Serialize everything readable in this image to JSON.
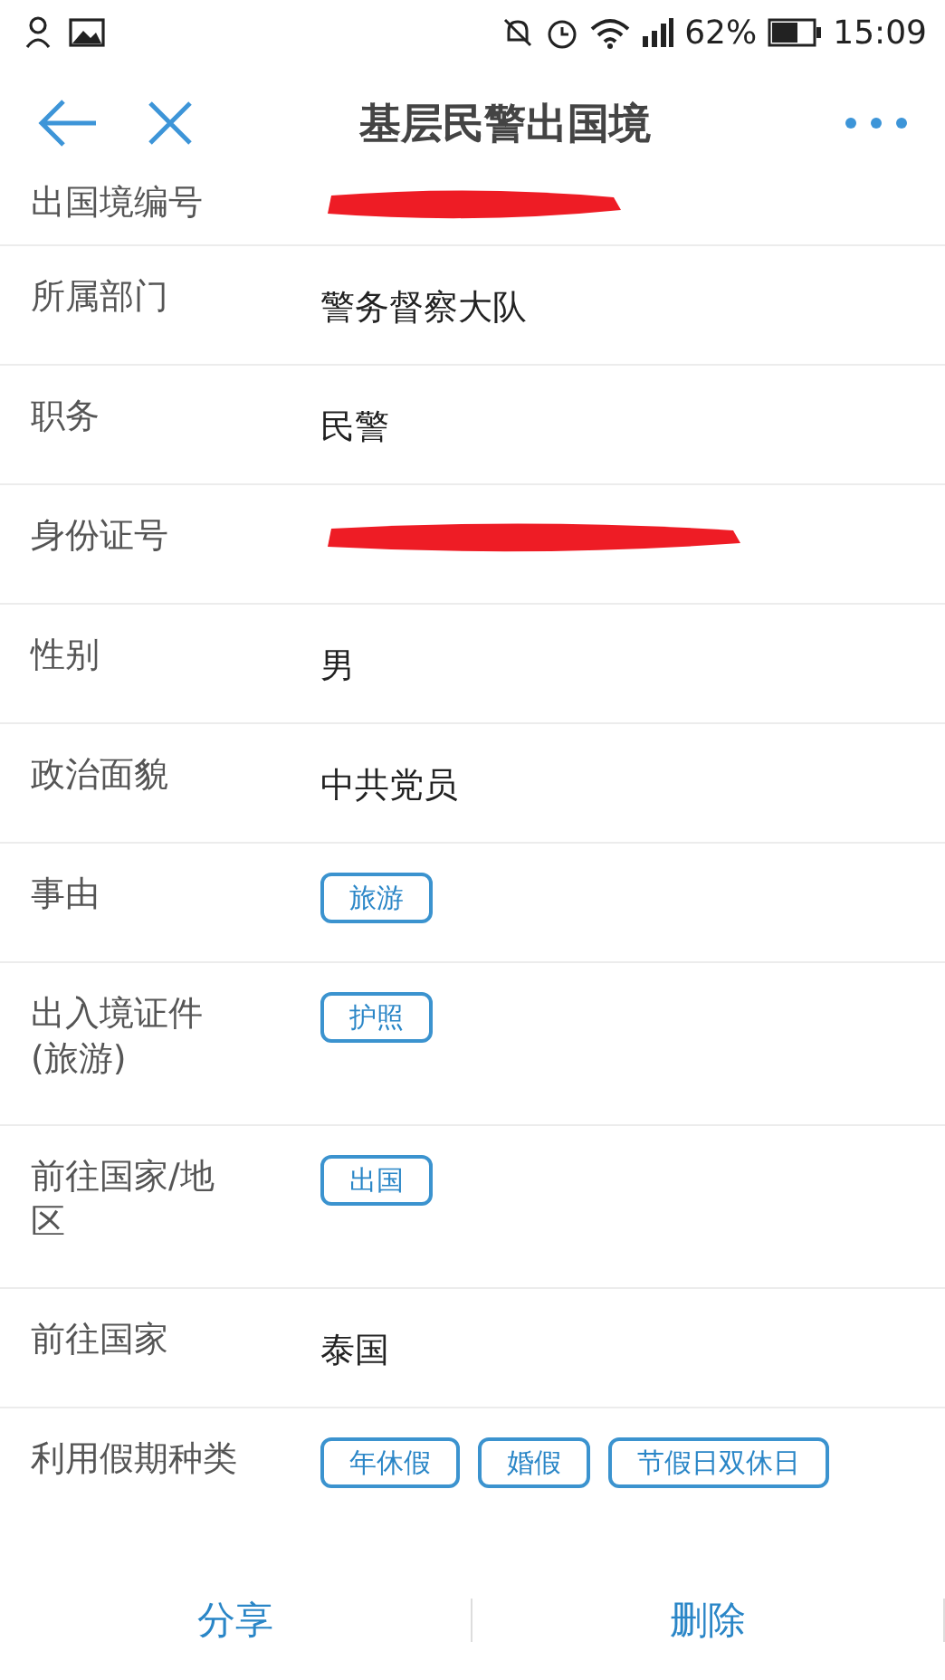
{
  "status_bar": {
    "battery": "62%",
    "time": "15:09"
  },
  "header": {
    "title": "基层民警出国境"
  },
  "fields": [
    {
      "label": "出国境编号",
      "kind": "redacted"
    },
    {
      "label": "所属部门",
      "kind": "text",
      "value": "警务督察大队"
    },
    {
      "label": "职务",
      "kind": "text",
      "value": "民警"
    },
    {
      "label": "身份证号",
      "kind": "redacted"
    },
    {
      "label": "性别",
      "kind": "text",
      "value": "男"
    },
    {
      "label": "政治面貌",
      "kind": "text",
      "value": "中共党员"
    },
    {
      "label": "事由",
      "kind": "tags",
      "tags": [
        "旅游"
      ]
    },
    {
      "label": "出入境证件(旅游)",
      "kind": "tags",
      "tags": [
        "护照"
      ]
    },
    {
      "label": "前往国家/地区",
      "kind": "tags",
      "tags": [
        "出国"
      ]
    },
    {
      "label": "前往国家",
      "kind": "text",
      "value": "泰国"
    },
    {
      "label": "利用假期种类",
      "kind": "tags",
      "tags": [
        "年休假",
        "婚假",
        "节假日双休日"
      ]
    }
  ],
  "footer": {
    "buttons": [
      "分享",
      "删除"
    ]
  }
}
